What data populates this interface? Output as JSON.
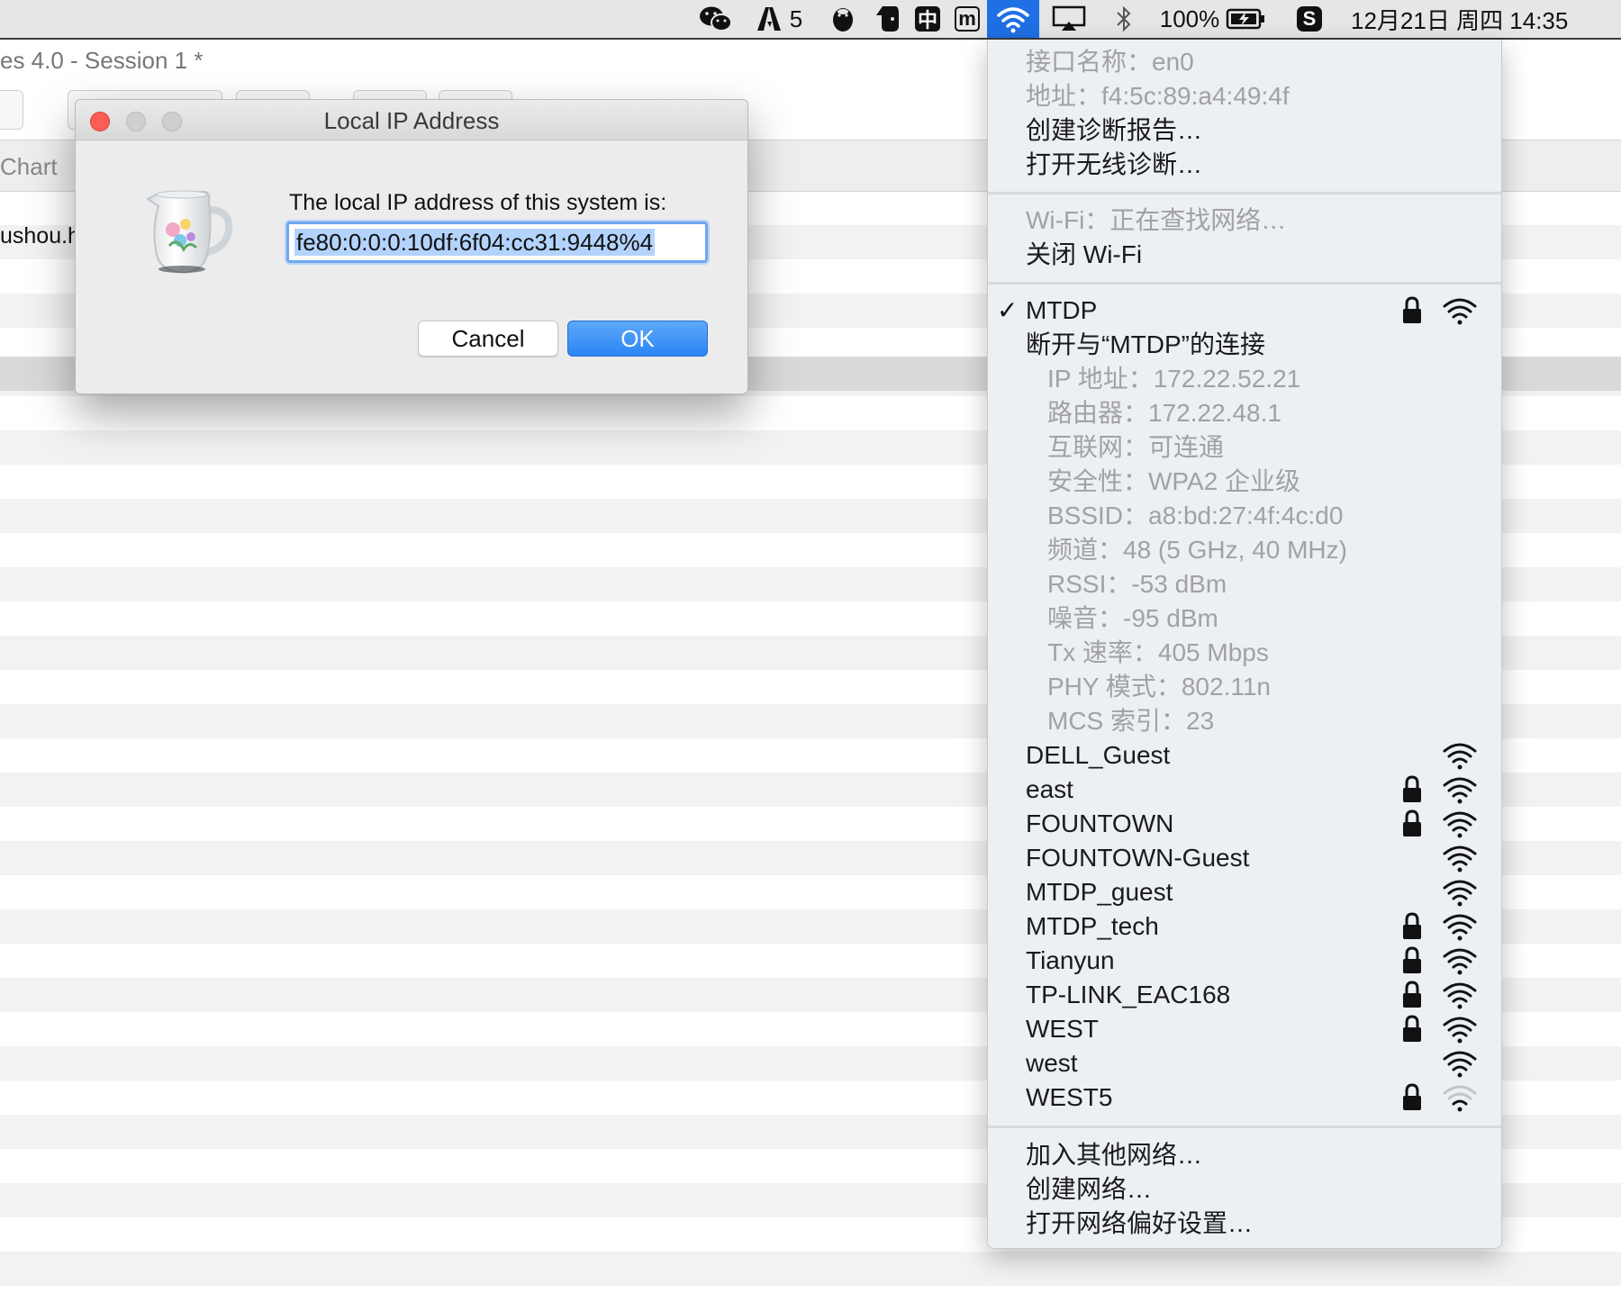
{
  "menubar": {
    "status_icons": [
      "wechat-icon",
      "adobe-icon",
      "qq-penguin-icon",
      "evernote-icon",
      "chinese-input-icon",
      "m-app-icon",
      "wifi-icon",
      "airplay-icon",
      "bluetooth-icon",
      "battery-icon",
      "sogou-input-icon"
    ],
    "adobe_count": "5",
    "input_method_char": "中",
    "m_char": "m",
    "battery_percent": "100%",
    "sogou_char": "S",
    "datetime": "12月21日 周四 14:35",
    "active_color": "#1f6fe5"
  },
  "app": {
    "title": "es 4.0 - Session 1 *",
    "header_label": "Chart",
    "host_text": "ushou.h"
  },
  "dialog": {
    "title": "Local IP Address",
    "icon": "pitcher-icon",
    "message": "The local IP address of this system is:",
    "ip_value": "fe80:0:0:0:10df:6f04:cc31:9448%4",
    "cancel_label": "Cancel",
    "ok_label": "OK",
    "ok_color": "#2a85f3"
  },
  "wifi_menu": {
    "interface_name": "接口名称：en0",
    "address": "地址：f4:5c:89:a4:49:4f",
    "create_diagnostics": "创建诊断报告…",
    "open_wireless_diagnostics": "打开无线诊断…",
    "wifi_status": "Wi-Fi：正在查找网络…",
    "turn_off_wifi": "关闭 Wi-Fi",
    "connected_network": "MTDP",
    "disconnect": "断开与“MTDP”的连接",
    "details": [
      "IP 地址：172.22.52.21",
      "路由器：172.22.48.1",
      "互联网：可连通",
      "安全性：WPA2 企业级",
      "BSSID：a8:bd:27:4f:4c:d0",
      "频道：48 (5 GHz, 40 MHz)",
      "RSSI：-53 dBm",
      "噪音：-95 dBm",
      "Tx 速率：405 Mbps",
      "PHY 模式：802.11n",
      "MCS 索引：23"
    ],
    "networks": [
      {
        "name": "DELL_Guest",
        "locked": false,
        "weak": false
      },
      {
        "name": "east",
        "locked": true,
        "weak": false
      },
      {
        "name": "FOUNTOWN",
        "locked": true,
        "weak": false
      },
      {
        "name": "FOUNTOWN-Guest",
        "locked": false,
        "weak": false
      },
      {
        "name": "MTDP_guest",
        "locked": false,
        "weak": false
      },
      {
        "name": "MTDP_tech",
        "locked": true,
        "weak": false
      },
      {
        "name": "Tianyun",
        "locked": true,
        "weak": false
      },
      {
        "name": "TP-LINK_EAC168",
        "locked": true,
        "weak": false
      },
      {
        "name": "WEST",
        "locked": true,
        "weak": false
      },
      {
        "name": "west",
        "locked": false,
        "weak": false
      },
      {
        "name": "WEST5",
        "locked": true,
        "weak": true
      }
    ],
    "join_other": "加入其他网络…",
    "create_network": "创建网络…",
    "open_preferences": "打开网络偏好设置…"
  }
}
